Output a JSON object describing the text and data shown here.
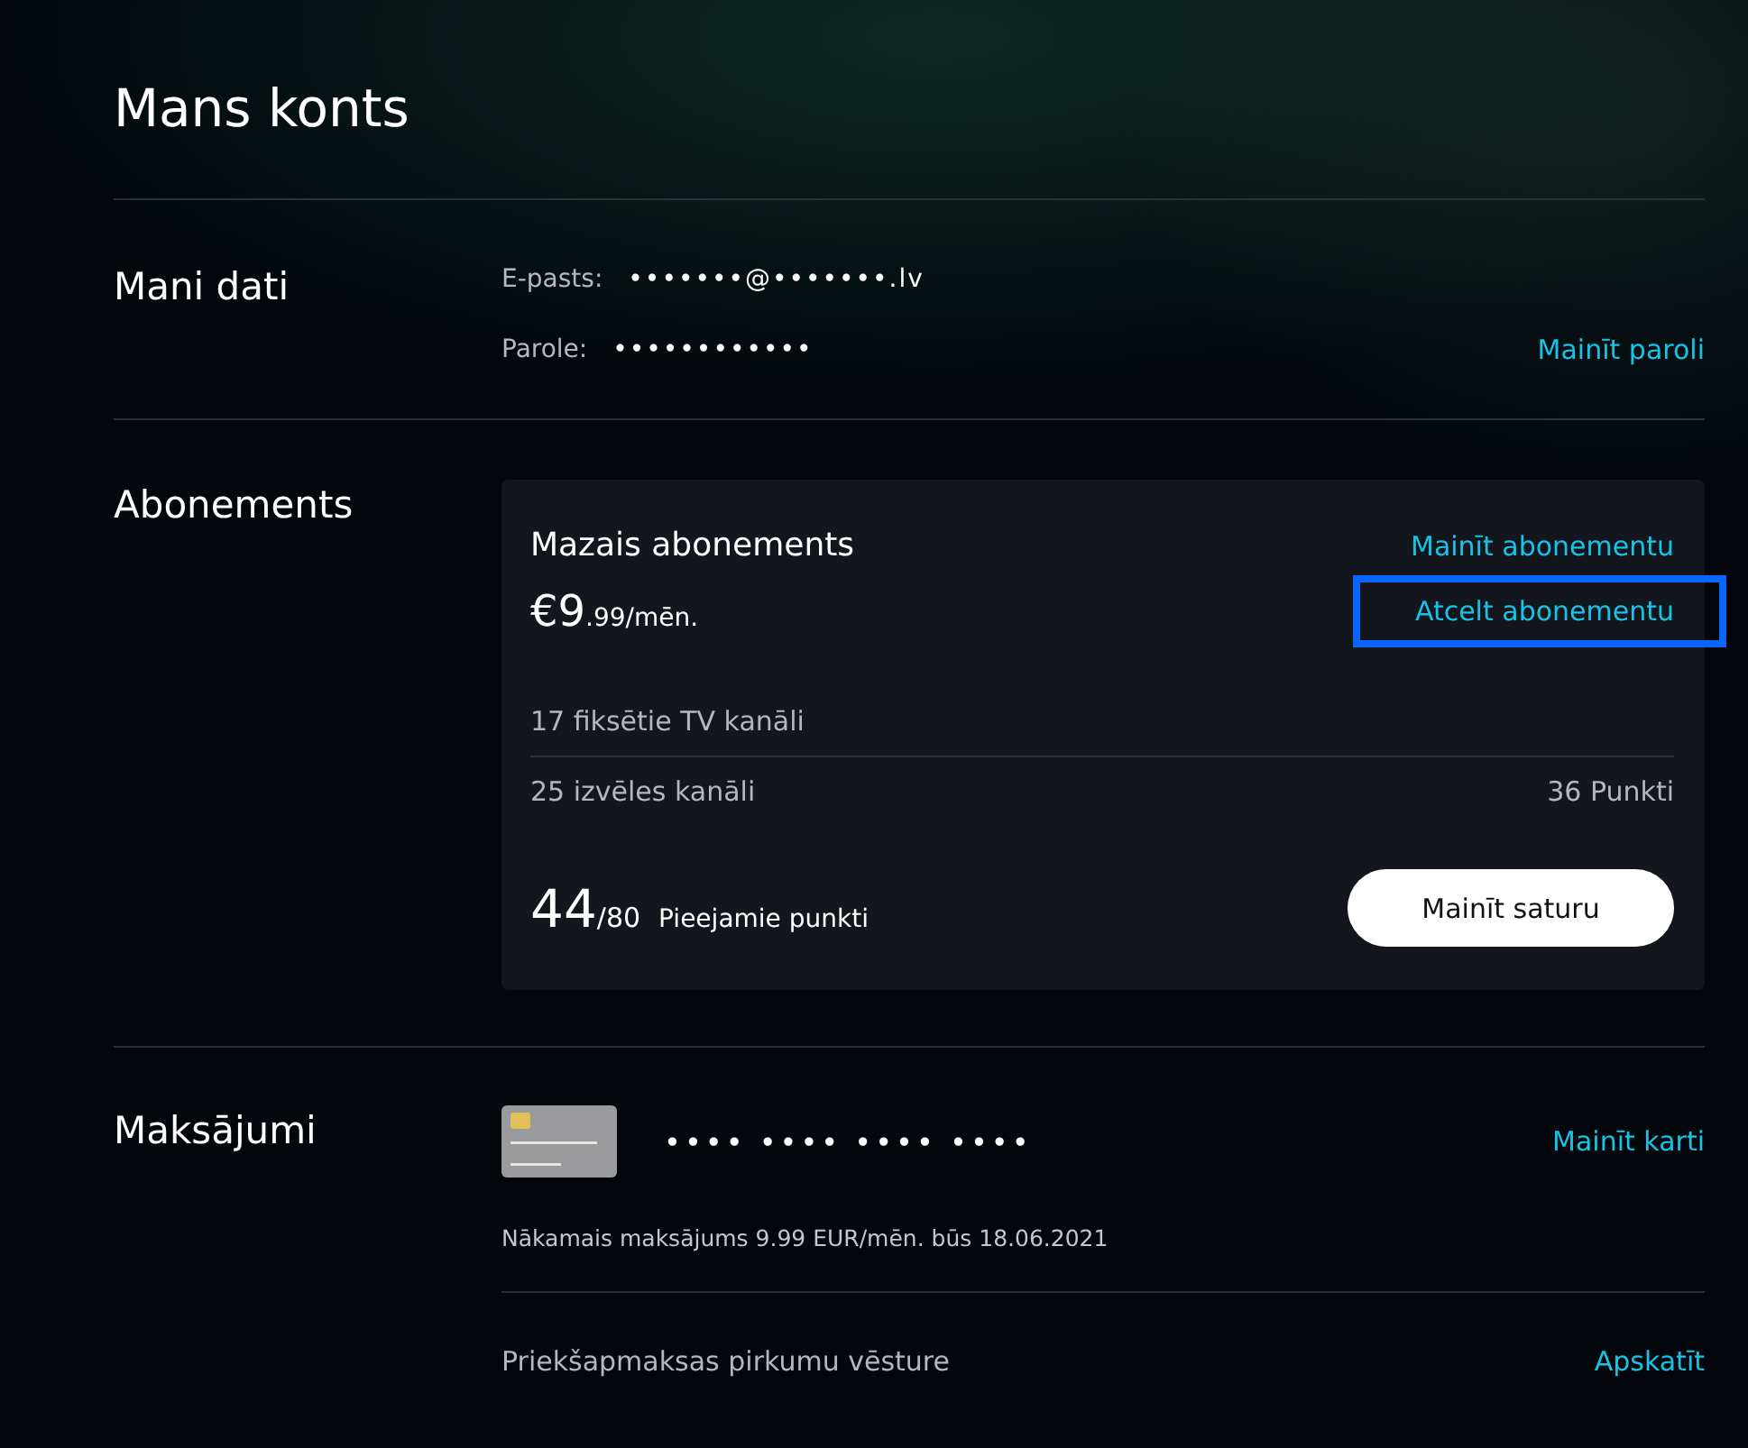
{
  "title": "Mans konts",
  "personal": {
    "heading": "Mani dati",
    "fields": [
      {
        "label": "E-pasts:",
        "value": "•••••••@•••••••.lv"
      },
      {
        "label": "Parole:",
        "value": "••••••••••••"
      }
    ],
    "link": "Mainīt paroli"
  },
  "subscription": {
    "heading": "Abonements",
    "plan": "Mazais abonements",
    "price_main": "€9",
    "price_rest": ".99/mēn.",
    "links": [
      {
        "label": "Mainīt abonementu",
        "focused": false
      },
      {
        "label": "Atcelt abonementu",
        "focused": true
      }
    ],
    "rows": [
      {
        "label": "17 fiksētie TV kanāli"
      },
      {
        "label": "25 izvēles kanāli",
        "value": "36 Punkti"
      }
    ],
    "points_big": "44",
    "points_total": "/80",
    "points_label": "Pieejamie punkti",
    "button": "Mainīt saturu"
  },
  "payments": {
    "heading": "Maksājumi",
    "card_number": "•••• •••• •••• ••••",
    "link": "Mainīt karti",
    "next_payment": "Nākamais maksājums 9.99 EUR/mēn. būs 18.06.2021",
    "history": "Priekšapmaksas pirkumu vēsture",
    "history_link": "Apskatīt"
  }
}
